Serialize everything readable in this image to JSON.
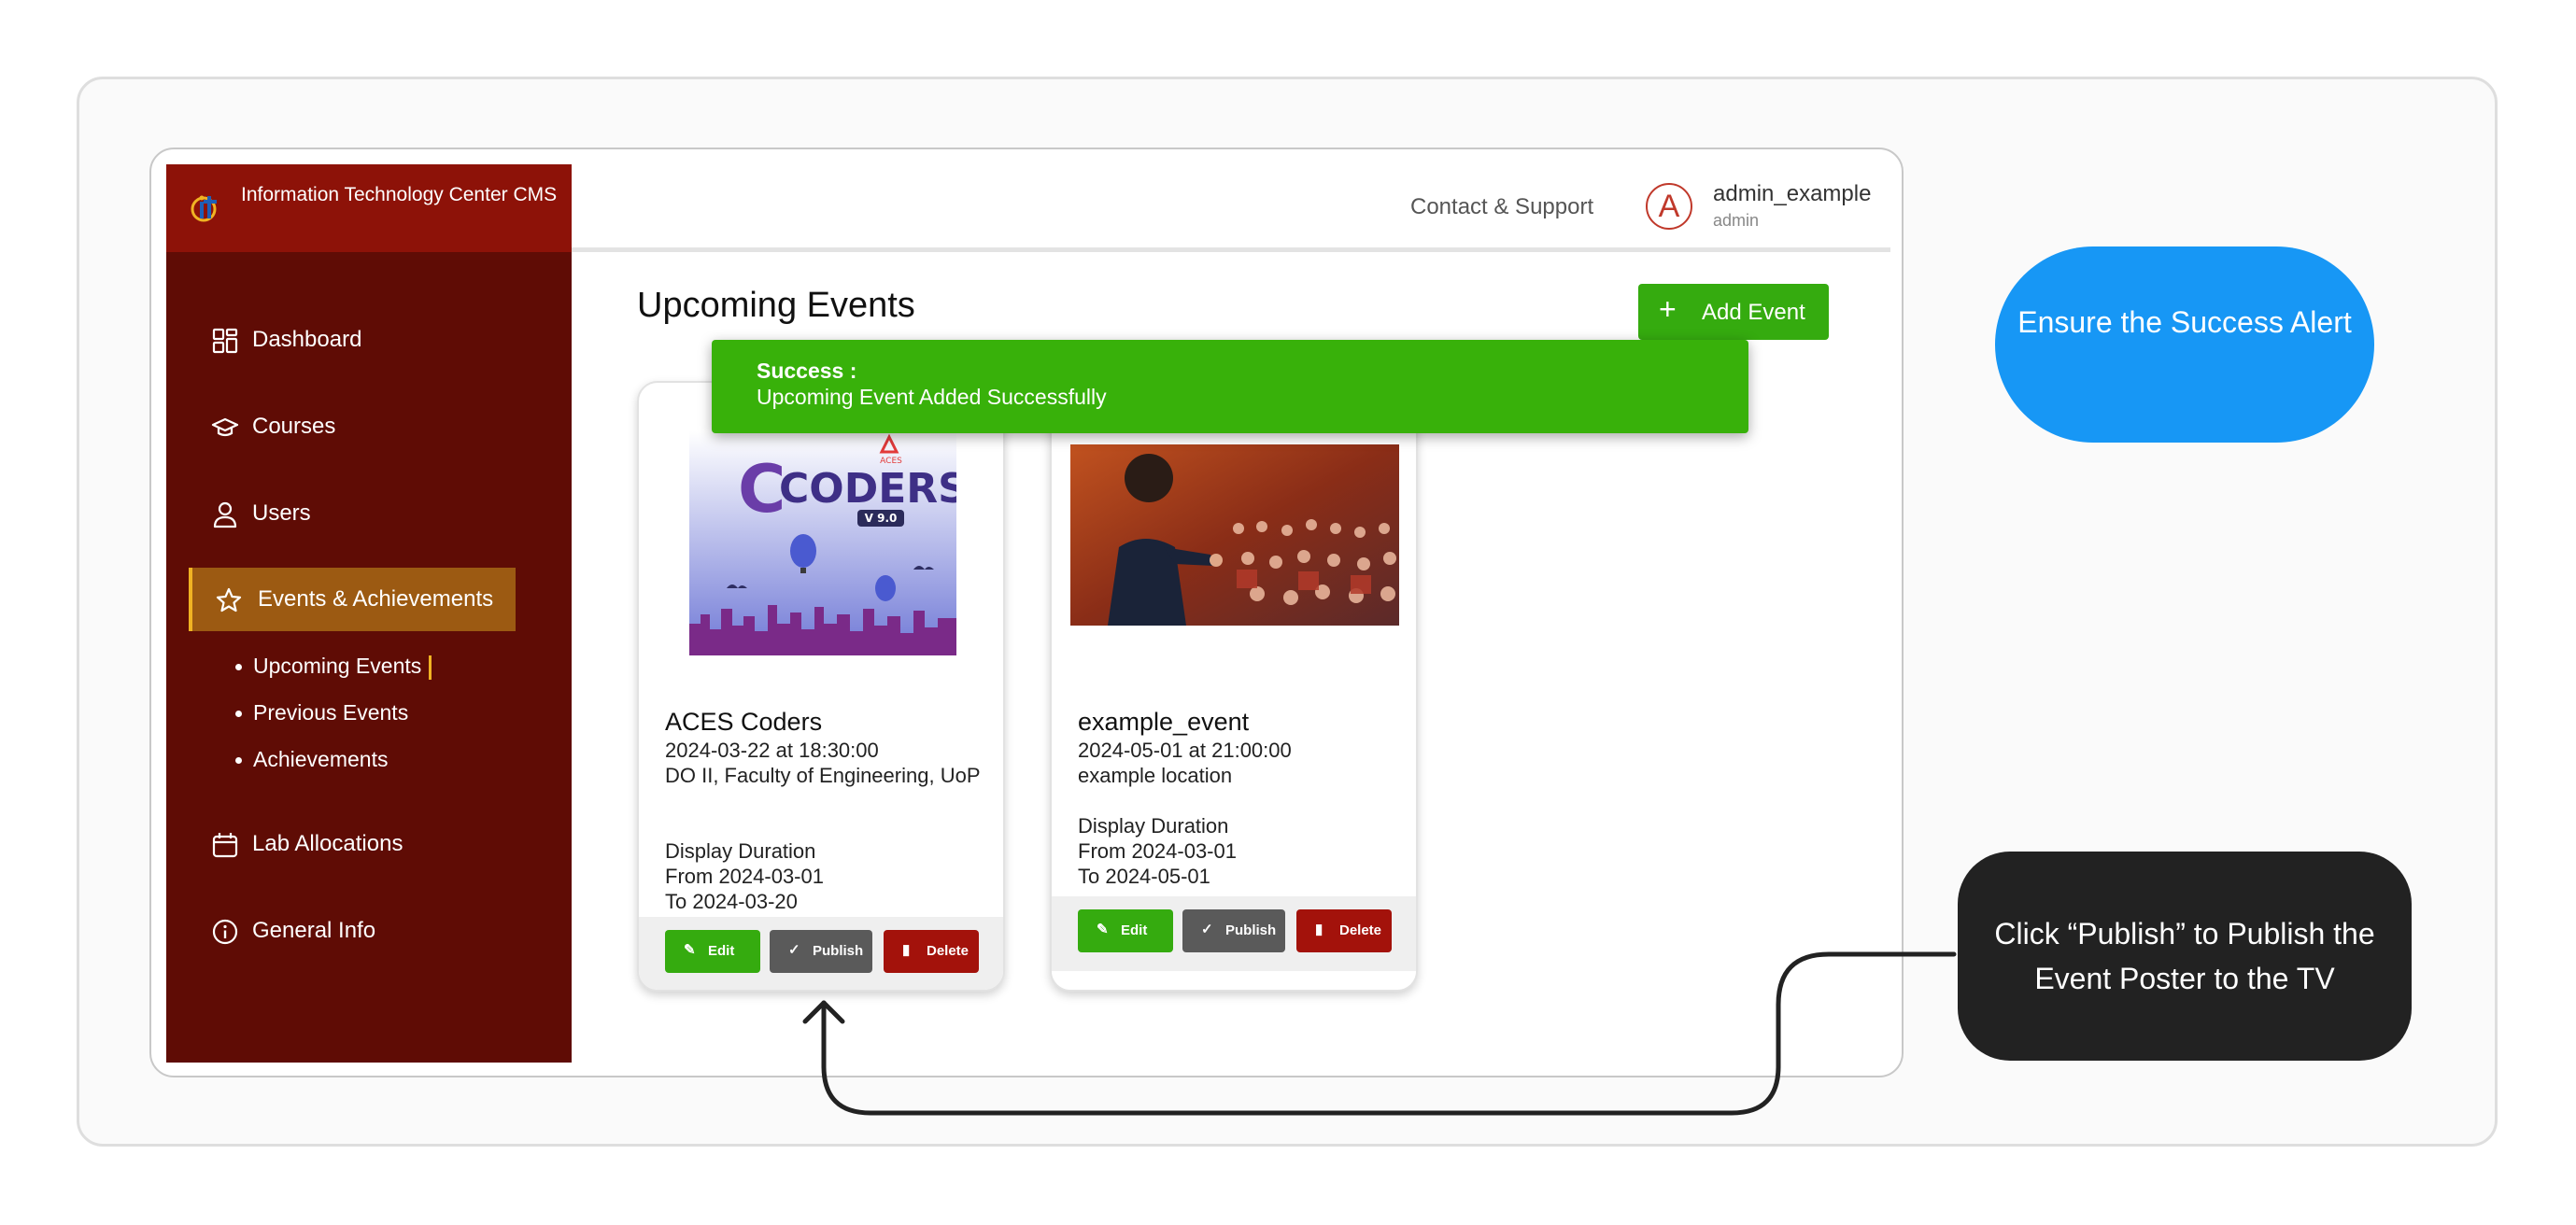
{
  "brand": {
    "name": "Information Technology Center CMS"
  },
  "sidebar": {
    "items": [
      {
        "label": "Dashboard",
        "icon": "dashboard-icon"
      },
      {
        "label": "Courses",
        "icon": "graduation-cap-icon"
      },
      {
        "label": "Users",
        "icon": "user-icon"
      },
      {
        "label": "Events & Achievements",
        "icon": "star-icon",
        "active": true
      },
      {
        "label": "Lab Allocations",
        "icon": "calendar-icon"
      },
      {
        "label": "General Info",
        "icon": "info-icon"
      }
    ],
    "sub_items": [
      {
        "label": "Upcoming Events",
        "active": true
      },
      {
        "label": "Previous Events"
      },
      {
        "label": "Achievements"
      }
    ]
  },
  "header": {
    "contact": "Contact & Support",
    "avatar_letter": "A",
    "username": "admin_example",
    "role": "admin"
  },
  "main": {
    "title": "Upcoming Events",
    "add_button": "Add Event"
  },
  "toast": {
    "title": "Success :",
    "message": "Upcoming Event Added Successfully"
  },
  "events": [
    {
      "title": "ACES Coders",
      "datetime": "2024-03-22 at 18:30:00",
      "location": "DO II, Faculty of Engineering, UoP",
      "duration_label": "Display Duration",
      "from": "From 2024-03-01",
      "to": "To 2024-03-20",
      "poster_text": "CODERS",
      "poster_version": "V 9.0",
      "poster_badge": "ACES",
      "edit": "Edit",
      "publish": "Publish",
      "delete": "Delete"
    },
    {
      "title": "example_event",
      "datetime": "2024-05-01 at 21:00:00",
      "location": "example location",
      "duration_label": "Display Duration",
      "from": "From 2024-03-01",
      "to": "To 2024-05-01",
      "edit": "Edit",
      "publish": "Publish",
      "delete": "Delete"
    }
  ],
  "callouts": {
    "success": "Ensure the Success Alert",
    "publish": "Click “Publish” to Publish the Event Poster to the TV"
  },
  "colors": {
    "sidebar": "#5f0c05",
    "brand": "#8d1208",
    "active_nav": "#9c5a12",
    "success": "#38b10a",
    "danger": "#a3120b",
    "callout_blue": "#1797f5",
    "callout_dark": "#222222"
  }
}
